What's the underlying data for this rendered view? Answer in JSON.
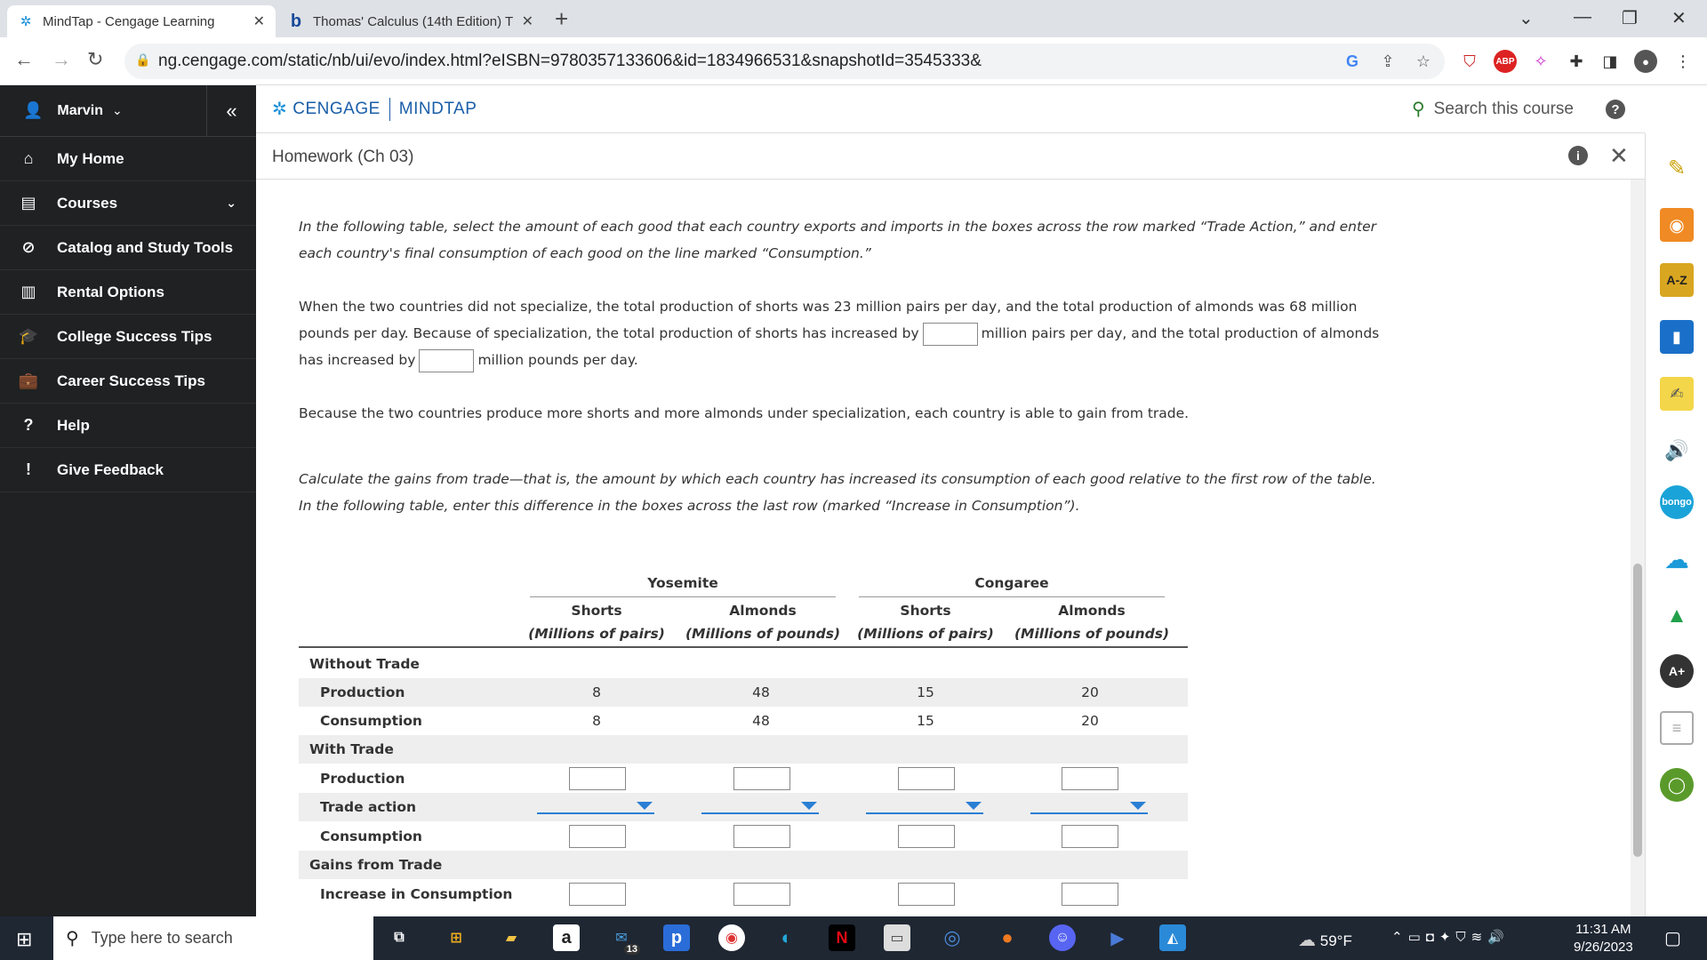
{
  "browser": {
    "tabs": [
      {
        "title": "MindTap - Cengage Learning",
        "active": true
      },
      {
        "title": "Thomas' Calculus (14th Edition) T",
        "active": false
      }
    ],
    "url": "ng.cengage.com/static/nb/ui/evo/index.html?eISBN=9780357133606&id=1834966531&snapshotId=3545333&"
  },
  "sidebar": {
    "user": "Marvin",
    "items": [
      {
        "label": "My Home"
      },
      {
        "label": "Courses"
      },
      {
        "label": "Catalog and Study Tools"
      },
      {
        "label": "Rental Options"
      },
      {
        "label": "College Success Tips"
      },
      {
        "label": "Career Success Tips"
      },
      {
        "label": "Help"
      },
      {
        "label": "Give Feedback"
      }
    ]
  },
  "header": {
    "brand1": "CENGAGE",
    "brand2": "MINDTAP",
    "search_label": "Search this course",
    "assignment_title": "Homework (Ch 03)"
  },
  "content": {
    "instr1": "In the following table, select the amount of each good that each country exports and imports in the boxes across the row marked “Trade Action,” and enter each country's final consumption of each good on the line marked “Consumption.”",
    "p2a": "When the two countries did not specialize, the total production of shorts was 23 million pairs per day, and the total production of almonds was 68 million pounds per day. Because of specialization, the total production of shorts has increased by",
    "p2b": "million pairs per day, and the total production of almonds has increased by",
    "p2c": "million pounds per day.",
    "p3": "Because the two countries produce more shorts and more almonds under specialization, each country is able to gain from trade.",
    "instr2": "Calculate the gains from trade—that is, the amount by which each country has increased its consumption of each good relative to the first row of the table. In the following table, enter this difference in the boxes across the last row (marked “Increase in Consumption”)."
  },
  "table": {
    "groups": [
      "Yosemite",
      "Congaree"
    ],
    "columns": [
      {
        "name": "Shorts",
        "unit": "(Millions of pairs)"
      },
      {
        "name": "Almonds",
        "unit": "(Millions of pounds)"
      },
      {
        "name": "Shorts",
        "unit": "(Millions of pairs)"
      },
      {
        "name": "Almonds",
        "unit": "(Millions of pounds)"
      }
    ],
    "sections": {
      "without": "Without Trade",
      "with": "With Trade",
      "gains": "Gains from Trade"
    },
    "rows": {
      "production": "Production",
      "consumption": "Consumption",
      "trade_action": "Trade action",
      "increase": "Increase in Consumption"
    },
    "without_production": [
      "8",
      "48",
      "15",
      "20"
    ],
    "without_consumption": [
      "8",
      "48",
      "15",
      "20"
    ]
  },
  "taskbar": {
    "search_placeholder": "Type here to search",
    "mail_badge": "13",
    "temperature": "59°F",
    "time": "11:31 AM",
    "date": "9/26/2023"
  }
}
